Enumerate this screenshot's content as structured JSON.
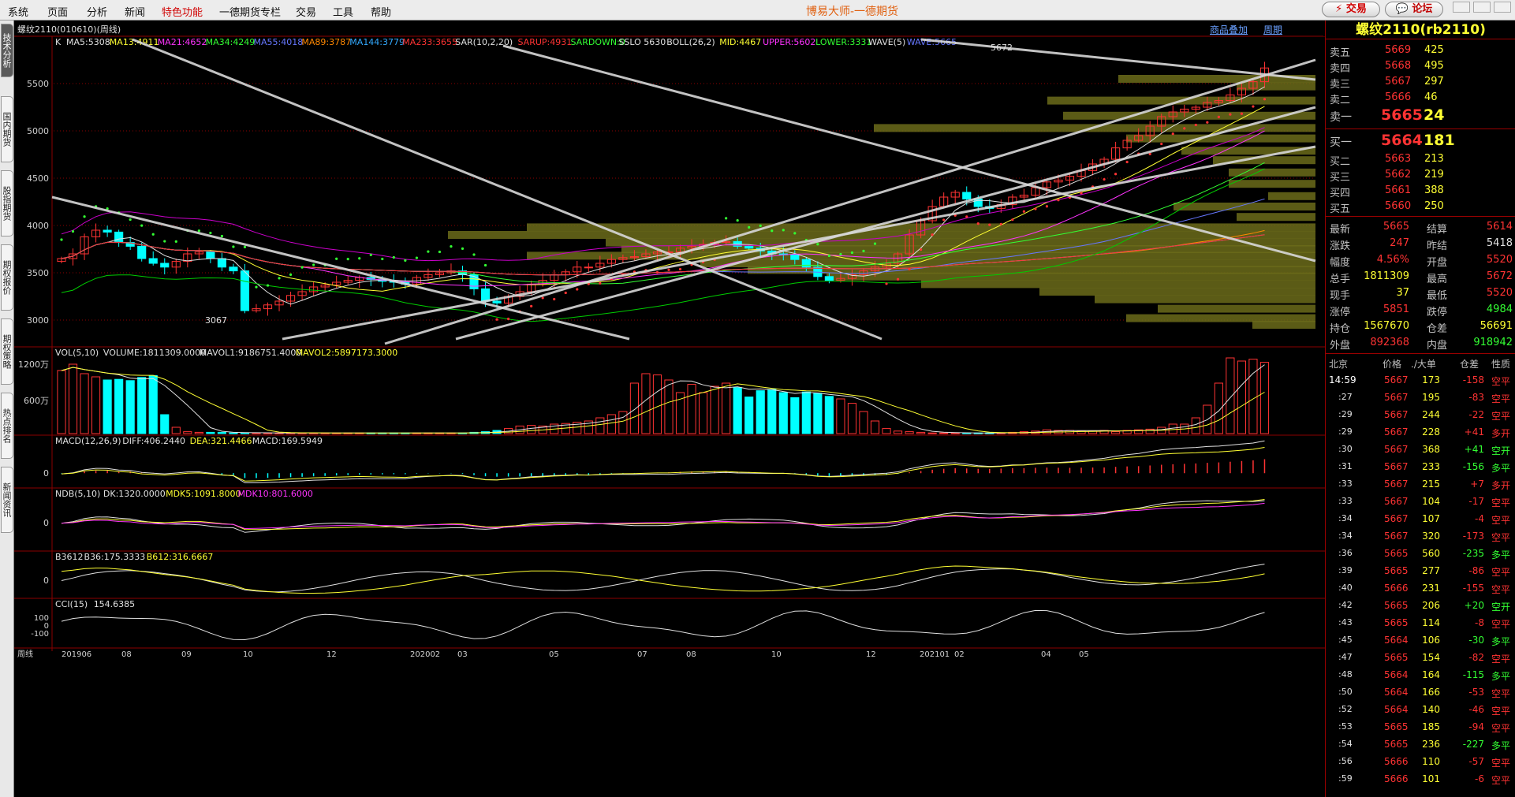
{
  "menu": [
    "系统",
    "页面",
    "分析",
    "新闻",
    "特色功能",
    "一德期货专栏",
    "交易",
    "工具",
    "帮助"
  ],
  "app_title": "博易大师-一德期货",
  "trade_button": "交易",
  "forum_button": "论坛",
  "side_tabs": [
    "技术分析",
    "国内期货",
    "股指期货",
    "期权报价",
    "期权策略",
    "热点排名",
    "新闻资讯"
  ],
  "chart": {
    "instrument": "螺纹2110(010610)(周线)",
    "link_add": "商品叠加",
    "link_period": "周期",
    "main_indicator_label": "K",
    "main_indicators": [
      {
        "text": "MA5:5308",
        "color": "#e0e0e0"
      },
      {
        "text": "MA13:4911",
        "color": "#ffff33"
      },
      {
        "text": "MA21:4652",
        "color": "#ff33ff"
      },
      {
        "text": "MA34:4249",
        "color": "#33ff33"
      },
      {
        "text": "MA55:4018",
        "color": "#6677ff"
      },
      {
        "text": "MA89:3787",
        "color": "#ff8800"
      },
      {
        "text": "MA144:3779",
        "color": "#33aaff"
      },
      {
        "text": "MA233:3655",
        "color": "#ff3333"
      },
      {
        "text": "SAR(10,2,20)",
        "color": "#e0e0e0"
      },
      {
        "text": "SARUP:4931",
        "color": "#ff3333"
      },
      {
        "text": "SARDOWN:0",
        "color": "#33ff33"
      },
      {
        "text": "SSLO 5630",
        "color": "#e0e0e0"
      },
      {
        "text": "BOLL(26,2)",
        "color": "#e0e0e0"
      },
      {
        "text": "MID:4467",
        "color": "#ffff33"
      },
      {
        "text": "UPPER:5602",
        "color": "#ff33ff"
      },
      {
        "text": "LOWER:3331",
        "color": "#33ff33"
      },
      {
        "text": "WAVE(5)",
        "color": "#e0e0e0"
      },
      {
        "text": "WAVE:5665",
        "color": "#6677ff"
      }
    ],
    "price_axis": [
      "5500",
      "5000",
      "4500",
      "4000",
      "3500",
      "3000"
    ],
    "high_label": "5672",
    "low_label": "3067",
    "vol_title": "VOL(5,10)",
    "vol_values": [
      {
        "text": "VOLUME:1811309.0000",
        "color": "#e0e0e0"
      },
      {
        "text": "MAVOL1:9186751.4000",
        "color": "#e0e0e0"
      },
      {
        "text": "MAVOL2:5897173.3000",
        "color": "#ffff33"
      }
    ],
    "vol_axis": [
      "1200万",
      "600万"
    ],
    "macd_title": "MACD(12,26,9)",
    "macd_values": [
      {
        "text": "DIFF:406.2440",
        "color": "#e0e0e0"
      },
      {
        "text": "DEA:321.4466",
        "color": "#ffff33"
      },
      {
        "text": "MACD:169.5949",
        "color": "#e0e0e0"
      }
    ],
    "macd_axis": [
      "0"
    ],
    "ndb_title": "NDB(5,10)",
    "ndb_values": [
      {
        "text": "DK:1320.0000",
        "color": "#e0e0e0"
      },
      {
        "text": "MDK5:1091.8000",
        "color": "#ffff33"
      },
      {
        "text": "MDK10:801.6000",
        "color": "#ff33ff"
      }
    ],
    "ndb_axis": [
      "0"
    ],
    "b36_title": "B3612",
    "b36_values": [
      {
        "text": "B36:175.3333",
        "color": "#e0e0e0"
      },
      {
        "text": "B612:316.6667",
        "color": "#ffff33"
      }
    ],
    "b36_axis": [
      "0"
    ],
    "cci_title": "CCI(15)",
    "cci_values": [
      {
        "text": "154.6385",
        "color": "#e0e0e0"
      }
    ],
    "cci_axis": [
      "100",
      "0",
      "-100"
    ],
    "time_axis": [
      "周线",
      "201906",
      "08",
      "09",
      "10",
      "12",
      "202002",
      "03",
      "05",
      "07",
      "08",
      "10",
      "12",
      "202101",
      "02",
      "04",
      "05"
    ]
  },
  "quote": {
    "title": "螺纹2110(rb2110)",
    "asks": [
      {
        "label": "卖五",
        "price": "5669",
        "vol": "425"
      },
      {
        "label": "卖四",
        "price": "5668",
        "vol": "495"
      },
      {
        "label": "卖三",
        "price": "5667",
        "vol": "297"
      },
      {
        "label": "卖二",
        "price": "5666",
        "vol": "46"
      },
      {
        "label": "卖一",
        "price": "5665",
        "vol": "24"
      }
    ],
    "bids": [
      {
        "label": "买一",
        "price": "5664",
        "vol": "181"
      },
      {
        "label": "买二",
        "price": "5663",
        "vol": "213"
      },
      {
        "label": "买三",
        "price": "5662",
        "vol": "219"
      },
      {
        "label": "买四",
        "price": "5661",
        "vol": "388"
      },
      {
        "label": "买五",
        "price": "5660",
        "vol": "250"
      }
    ],
    "stats": [
      {
        "l1": "最新",
        "v1": "5665",
        "c1": "r",
        "l2": "结算",
        "v2": "5614",
        "c2": "r"
      },
      {
        "l1": "涨跌",
        "v1": "247",
        "c1": "r",
        "l2": "昨结",
        "v2": "5418",
        "c2": "w"
      },
      {
        "l1": "幅度",
        "v1": "4.56%",
        "c1": "r",
        "l2": "开盘",
        "v2": "5520",
        "c2": "r"
      },
      {
        "l1": "总手",
        "v1": "1811309",
        "c1": "y",
        "l2": "最高",
        "v2": "5672",
        "c2": "r"
      },
      {
        "l1": "现手",
        "v1": "37",
        "c1": "y",
        "l2": "最低",
        "v2": "5520",
        "c2": "r"
      },
      {
        "l1": "涨停",
        "v1": "5851",
        "c1": "r",
        "l2": "跌停",
        "v2": "4984",
        "c2": "g"
      },
      {
        "l1": "持仓",
        "v1": "1567670",
        "c1": "y",
        "l2": "仓差",
        "v2": "56691",
        "c2": "y"
      },
      {
        "l1": "外盘",
        "v1": "892368",
        "c1": "r",
        "l2": "内盘",
        "v2": "918942",
        "c2": "g"
      }
    ],
    "ticks_header": [
      "北京",
      "价格",
      "./大单",
      "仓差",
      "性质"
    ],
    "ticks": [
      {
        "t": "14:59",
        "p": "5667",
        "v": "173",
        "d": "-158",
        "n": "空平",
        "dc": "r",
        "nc": "r"
      },
      {
        "t": ":27",
        "p": "5667",
        "v": "195",
        "d": "-83",
        "n": "空平",
        "dc": "r",
        "nc": "r"
      },
      {
        "t": ":29",
        "p": "5667",
        "v": "244",
        "d": "-22",
        "n": "空平",
        "dc": "r",
        "nc": "r"
      },
      {
        "t": ":29",
        "p": "5667",
        "v": "228",
        "d": "+41",
        "n": "多开",
        "dc": "r",
        "nc": "r"
      },
      {
        "t": ":30",
        "p": "5667",
        "v": "368",
        "d": "+41",
        "n": "空开",
        "dc": "g",
        "nc": "g"
      },
      {
        "t": ":31",
        "p": "5667",
        "v": "233",
        "d": "-156",
        "n": "多平",
        "dc": "g",
        "nc": "g"
      },
      {
        "t": ":33",
        "p": "5667",
        "v": "215",
        "d": "+7",
        "n": "多开",
        "dc": "r",
        "nc": "r"
      },
      {
        "t": ":33",
        "p": "5667",
        "v": "104",
        "d": "-17",
        "n": "空平",
        "dc": "r",
        "nc": "r"
      },
      {
        "t": ":34",
        "p": "5667",
        "v": "107",
        "d": "-4",
        "n": "空平",
        "dc": "r",
        "nc": "r"
      },
      {
        "t": ":34",
        "p": "5667",
        "v": "320",
        "d": "-173",
        "n": "空平",
        "dc": "r",
        "nc": "r"
      },
      {
        "t": ":36",
        "p": "5665",
        "v": "560",
        "d": "-235",
        "n": "多平",
        "dc": "g",
        "nc": "g"
      },
      {
        "t": ":39",
        "p": "5665",
        "v": "277",
        "d": "-86",
        "n": "空平",
        "dc": "r",
        "nc": "r"
      },
      {
        "t": ":40",
        "p": "5666",
        "v": "231",
        "d": "-155",
        "n": "空平",
        "dc": "r",
        "nc": "r"
      },
      {
        "t": ":42",
        "p": "5665",
        "v": "206",
        "d": "+20",
        "n": "空开",
        "dc": "g",
        "nc": "g"
      },
      {
        "t": ":43",
        "p": "5665",
        "v": "114",
        "d": "-8",
        "n": "空平",
        "dc": "r",
        "nc": "r"
      },
      {
        "t": ":45",
        "p": "5664",
        "v": "106",
        "d": "-30",
        "n": "多平",
        "dc": "g",
        "nc": "g"
      },
      {
        "t": ":47",
        "p": "5665",
        "v": "154",
        "d": "-82",
        "n": "空平",
        "dc": "r",
        "nc": "r"
      },
      {
        "t": ":48",
        "p": "5664",
        "v": "164",
        "d": "-115",
        "n": "多平",
        "dc": "g",
        "nc": "g"
      },
      {
        "t": ":50",
        "p": "5664",
        "v": "166",
        "d": "-53",
        "n": "空平",
        "dc": "r",
        "nc": "r"
      },
      {
        "t": ":52",
        "p": "5664",
        "v": "140",
        "d": "-46",
        "n": "空平",
        "dc": "r",
        "nc": "r"
      },
      {
        "t": ":53",
        "p": "5665",
        "v": "185",
        "d": "-94",
        "n": "空平",
        "dc": "r",
        "nc": "r"
      },
      {
        "t": ":54",
        "p": "5665",
        "v": "236",
        "d": "-227",
        "n": "多平",
        "dc": "g",
        "nc": "g"
      },
      {
        "t": ":56",
        "p": "5666",
        "v": "110",
        "d": "-57",
        "n": "空平",
        "dc": "r",
        "nc": "r"
      },
      {
        "t": ":59",
        "p": "5666",
        "v": "101",
        "d": "-6",
        "n": "空平",
        "dc": "r",
        "nc": "r"
      }
    ]
  },
  "colors": {
    "up": "#ff3333",
    "down": "#00ffff",
    "grid": "#8b0000",
    "bg": "#000000",
    "volume_profile": "#6b6b1a"
  }
}
